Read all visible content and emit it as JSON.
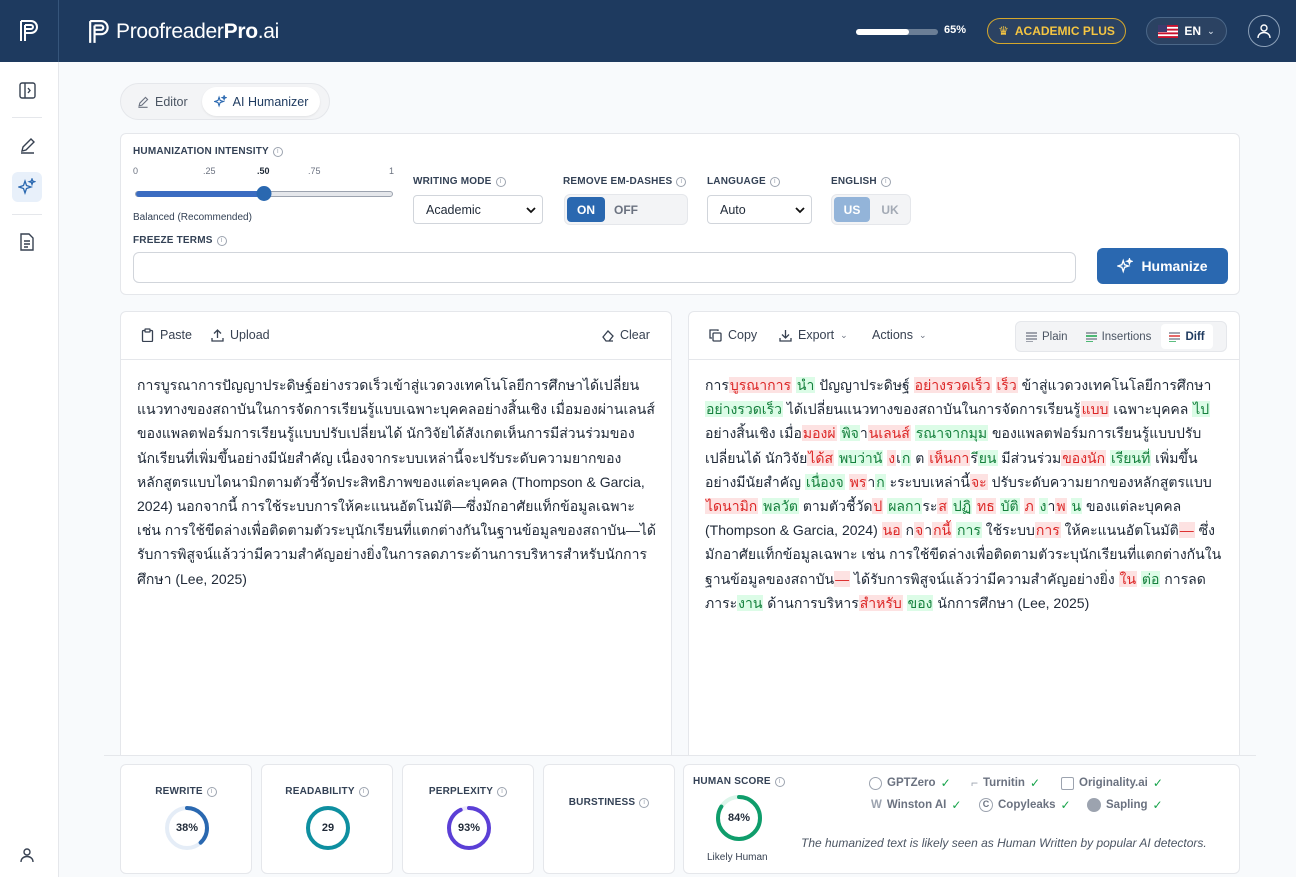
{
  "brand": {
    "name_prefix": "Proofreader",
    "name_bold": "Pro",
    "name_suffix": ".ai"
  },
  "topbar": {
    "progress_percent": 65,
    "progress_label": "65%",
    "plan_label": "ACADEMIC PLUS",
    "lang_label": "EN"
  },
  "tabs": [
    {
      "label": "Editor",
      "icon": "pencil-icon",
      "active": false
    },
    {
      "label": "AI Humanizer",
      "icon": "sparkles-icon",
      "active": true
    }
  ],
  "settings": {
    "intensity": {
      "label": "HUMANIZATION INTENSITY",
      "ticks": [
        "0",
        ".25",
        ".50",
        ".75",
        "1"
      ],
      "value": 0.5,
      "caption": "Balanced (Recommended)"
    },
    "writing_mode": {
      "label": "WRITING MODE",
      "value": "Academic"
    },
    "em_dashes": {
      "label": "REMOVE EM-DASHES",
      "on": "ON",
      "off": "OFF",
      "selected": "ON"
    },
    "language": {
      "label": "LANGUAGE",
      "value": "Auto"
    },
    "english": {
      "label": "ENGLISH",
      "us": "US",
      "uk": "UK",
      "selected": "US"
    },
    "freeze": {
      "label": "FREEZE TERMS",
      "value": ""
    },
    "humanize_label": "Humanize"
  },
  "left_pane": {
    "paste": "Paste",
    "upload": "Upload",
    "clear": "Clear",
    "text": "การบูรณาการปัญญาประดิษฐ์อย่างรวดเร็วเข้าสู่แวดวงเทคโนโลยีการศึกษาได้เปลี่ยนแนวทางของสถาบันในการจัดการเรียนรู้แบบเฉพาะบุคคลอย่างสิ้นเชิง เมื่อมองผ่านเลนส์ของแพลตฟอร์มการเรียนรู้แบบปรับเปลี่ยนได้ นักวิจัยได้สังเกตเห็นการมีส่วนร่วมของนักเรียนที่เพิ่มขึ้นอย่างมีนัยสำคัญ เนื่องจากระบบเหล่านี้จะปรับระดับความยากของหลักสูตรแบบไดนามิกตามตัวชี้วัดประสิทธิภาพของแต่ละบุคคล (Thompson & Garcia, 2024) นอกจากนี้ การใช้ระบบการให้คะแนนอัตโนมัติ—ซึ่งมักอาศัยแท็กข้อมูลเฉพาะ เช่น การใช้ขีดล่างเพื่อติดตามตัวระบุนักเรียนที่แตกต่างกันในฐานข้อมูลของสถาบัน—ได้รับการพิสูจน์แล้วว่ามีความสำคัญอย่างยิ่งในการลดภาระด้านการบริหารสำหรับนักการศึกษา (Lee, 2025)"
  },
  "right_pane": {
    "copy": "Copy",
    "export": "Export",
    "actions": "Actions",
    "views": [
      {
        "label": "Plain",
        "active": false
      },
      {
        "label": "Insertions",
        "active": false
      },
      {
        "label": "Diff",
        "active": true
      }
    ],
    "segments": [
      {
        "t": "การ",
        "k": "n"
      },
      {
        "t": "บูรณาการ",
        "k": "d"
      },
      {
        "t": " ",
        "k": "n"
      },
      {
        "t": "นำ",
        "k": "i"
      },
      {
        "t": " ปัญญาประดิษฐ์ ",
        "k": "n"
      },
      {
        "t": "อย่างรวดเร็ว",
        "k": "d"
      },
      {
        "t": " ",
        "k": "n"
      },
      {
        "t": "เร็ว",
        "k": "d"
      },
      {
        "t": " ข้าสู่แวดวงเทคโนโลยีการศึกษา ",
        "k": "n"
      },
      {
        "t": "อย่างรวดเร็ว",
        "k": "i"
      },
      {
        "t": " ได้เปลี่ยนแนวทางของสถาบันในการจัดการเรียนรู้",
        "k": "n"
      },
      {
        "t": "แบบ",
        "k": "d"
      },
      {
        "t": " เฉพาะบุคคล ",
        "k": "n"
      },
      {
        "t": "ไป",
        "k": "i"
      },
      {
        "t": " อย่างสิ้นเชิง เมื่อ",
        "k": "n"
      },
      {
        "t": "มองผ่",
        "k": "d"
      },
      {
        "t": " ",
        "k": "n"
      },
      {
        "t": "พิจ",
        "k": "i"
      },
      {
        "t": "า",
        "k": "n"
      },
      {
        "t": "นเลนส์",
        "k": "d"
      },
      {
        "t": " ",
        "k": "n"
      },
      {
        "t": "รณาจากมุม",
        "k": "i"
      },
      {
        "t": " ของแพลตฟอร์มการเรียนรู้แบบปรับเปลี่ยนได้ นักวิจัย",
        "k": "n"
      },
      {
        "t": "ได้ส",
        "k": "d"
      },
      {
        "t": " ",
        "k": "n"
      },
      {
        "t": "พบว่านั",
        "k": "i"
      },
      {
        "t": " ",
        "k": "n"
      },
      {
        "t": "ง",
        "k": "d"
      },
      {
        "t": "เ",
        "k": "n"
      },
      {
        "t": "ก",
        "k": "i"
      },
      {
        "t": " ต ",
        "k": "n"
      },
      {
        "t": "เห็นกา",
        "k": "d"
      },
      {
        "t": "ร",
        "k": "n"
      },
      {
        "t": "ียน",
        "k": "i"
      },
      {
        "t": " มีส่วนร่วม",
        "k": "n"
      },
      {
        "t": "ของนัก",
        "k": "d"
      },
      {
        "t": " ",
        "k": "n"
      },
      {
        "t": "เรียนที่",
        "k": "i"
      },
      {
        "t": " เพิ่มขึ้นอย่างมีนัยสำคัญ ",
        "k": "n"
      },
      {
        "t": "เนื่องจ",
        "k": "i"
      },
      {
        "t": " ",
        "k": "n"
      },
      {
        "t": "พร",
        "k": "d"
      },
      {
        "t": "า",
        "k": "n"
      },
      {
        "t": "ก",
        "k": "i"
      },
      {
        "t": " ะระบบเหล่านี้",
        "k": "n"
      },
      {
        "t": "จะ",
        "k": "d"
      },
      {
        "t": " ปรับระดับความยากของหลักสูตรแบบ ",
        "k": "n"
      },
      {
        "t": "ไดนามิก",
        "k": "d"
      },
      {
        "t": " ",
        "k": "n"
      },
      {
        "t": "พลวัต",
        "k": "i"
      },
      {
        "t": " ตามตัวชี้วัด",
        "k": "n"
      },
      {
        "t": "ป",
        "k": "d"
      },
      {
        "t": " ",
        "k": "n"
      },
      {
        "t": "ผลกา",
        "k": "i"
      },
      {
        "t": "ระ",
        "k": "n"
      },
      {
        "t": "ส",
        "k": "d"
      },
      {
        "t": " ",
        "k": "n"
      },
      {
        "t": "ปฏิ",
        "k": "i"
      },
      {
        "t": " ",
        "k": "n"
      },
      {
        "t": "ทธ",
        "k": "d"
      },
      {
        "t": " ",
        "k": "n"
      },
      {
        "t": "บัติ",
        "k": "i"
      },
      {
        "t": " ",
        "k": "n"
      },
      {
        "t": "ภ",
        "k": "d"
      },
      {
        "t": " ",
        "k": "n"
      },
      {
        "t": "ง",
        "k": "i"
      },
      {
        "t": "า",
        "k": "n"
      },
      {
        "t": "พ",
        "k": "d"
      },
      {
        "t": " ",
        "k": "n"
      },
      {
        "t": "น",
        "k": "i"
      },
      {
        "t": " ของแต่ละบุคคล (Thompson & Garcia, 2024) ",
        "k": "n"
      },
      {
        "t": "นอ",
        "k": "d"
      },
      {
        "t": " ก",
        "k": "n"
      },
      {
        "t": "จ",
        "k": "d"
      },
      {
        "t": "า",
        "k": "n"
      },
      {
        "t": "กนี้",
        "k": "d"
      },
      {
        "t": " ",
        "k": "n"
      },
      {
        "t": "การ",
        "k": "i"
      },
      {
        "t": " ใช้ระบบ",
        "k": "n"
      },
      {
        "t": "การ",
        "k": "d"
      },
      {
        "t": " ให้คะแนนอัตโนมัติ",
        "k": "n"
      },
      {
        "t": "—",
        "k": "d"
      },
      {
        "t": "  ซึ่งมักอาศัยแท็กข้อมูลเฉพาะ เช่น การใช้ขีดล่างเพื่อติดตามตัวระบุนักเรียนที่แตกต่างกันในฐานข้อมูลของสถาบัน",
        "k": "n"
      },
      {
        "t": "—",
        "k": "d"
      },
      {
        "t": "  ได้รับการพิสูจน์แล้วว่ามีความสำคัญอย่างยิ่ง ",
        "k": "n"
      },
      {
        "t": "ใน",
        "k": "d"
      },
      {
        "t": " ",
        "k": "n"
      },
      {
        "t": "ต่อ",
        "k": "i"
      },
      {
        "t": " การลดภาระ",
        "k": "n"
      },
      {
        "t": "งาน",
        "k": "i"
      },
      {
        "t": " ด้านการบริหาร",
        "k": "n"
      },
      {
        "t": "สำหรับ",
        "k": "d"
      },
      {
        "t": " ",
        "k": "n"
      },
      {
        "t": "ของ",
        "k": "i"
      },
      {
        "t": " นักการศึกษา (Lee, 2025)",
        "k": "n"
      }
    ]
  },
  "scores": {
    "rewrite": {
      "label": "REWRITE",
      "value": 38,
      "display": "38%",
      "color": "#2a68b0"
    },
    "readability": {
      "label": "READABILITY",
      "value": 29,
      "display": "29",
      "color": "#0e8fa0"
    },
    "perplexity": {
      "label": "PERPLEXITY",
      "value": 93,
      "display": "93%",
      "color": "#5b3fd6"
    },
    "burstiness": {
      "label": "BURSTINESS"
    },
    "human": {
      "label": "HUMAN SCORE",
      "value": 84,
      "display": "84%",
      "caption": "Likely Human",
      "color": "#0f9d6b"
    }
  },
  "detectors": [
    "GPTZero",
    "Turnitin",
    "Originality.ai",
    "Winston AI",
    "Copyleaks",
    "Sapling"
  ],
  "detector_note": "The humanized text is likely seen as Human Written by popular AI detectors."
}
